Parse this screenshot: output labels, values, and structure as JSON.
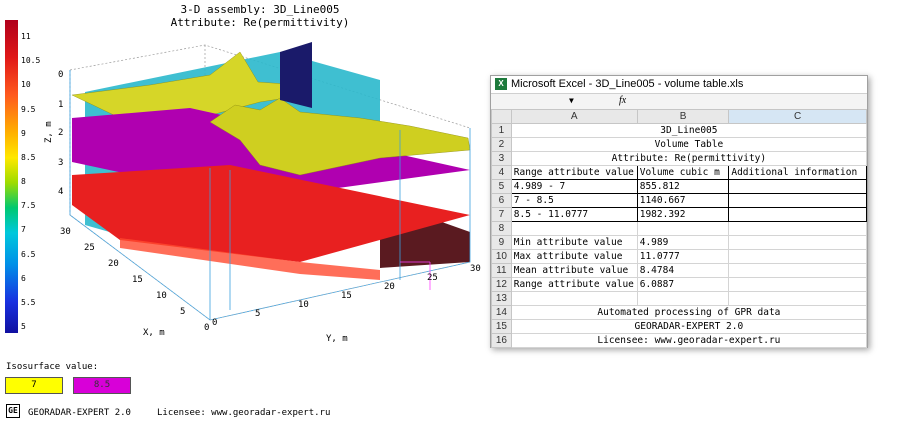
{
  "plot": {
    "title_line1": "3-D assembly: 3D_Line005",
    "title_line2": "Attribute: Re(permittivity)",
    "colorbar_ticks": [
      "11",
      "10.5",
      "10",
      "9.5",
      "9",
      "8.5",
      "8",
      "7.5",
      "7",
      "6.5",
      "6",
      "5.5",
      "5"
    ],
    "z_ticks": [
      "0",
      "1",
      "2",
      "3",
      "4"
    ],
    "x_ticks": [
      "30",
      "25",
      "20",
      "15",
      "10",
      "5",
      "0"
    ],
    "y_ticks": [
      "0",
      "5",
      "10",
      "15",
      "20",
      "25",
      "30"
    ],
    "z_label": "Z, m",
    "x_label": "X, m",
    "y_label": "Y, m",
    "colors": {
      "yellow_surface": "#dada22",
      "magenta_surface": "#b000b0",
      "cyan_surface": "#2ab8cc",
      "red_surface": "#e82020"
    }
  },
  "isosurface": {
    "label": "Isosurface value:",
    "value1": "7",
    "value2": "8.5",
    "color1": "#ffff00",
    "color2": "#d800d8"
  },
  "footer": {
    "logo": "GE",
    "brand": "GEORADAR-EXPERT 2.0",
    "licensee": "Licensee: www.georadar-expert.ru"
  },
  "excel": {
    "title": "Microsoft Excel - 3D_Line005 - volume table.xls",
    "icon": "X",
    "formula_dropdown": "▼",
    "fx": "fx",
    "columns": [
      "A",
      "B",
      "C"
    ],
    "rows": [
      {
        "n": "1",
        "merged": "3D_Line005"
      },
      {
        "n": "2",
        "merged": "Volume Table"
      },
      {
        "n": "3",
        "merged": "Attribute: Re(permittivity)"
      },
      {
        "n": "4",
        "a": "Range attribute value",
        "b": "Volume cubic m",
        "c": "Additional information"
      },
      {
        "n": "5",
        "a": "4.989 - 7",
        "b": "855.812",
        "c": ""
      },
      {
        "n": "6",
        "a": "7 - 8.5",
        "b": "1140.667",
        "c": ""
      },
      {
        "n": "7",
        "a": "8.5 - 11.0777",
        "b": "1982.392",
        "c": ""
      },
      {
        "n": "8",
        "a": "",
        "b": "",
        "c": ""
      },
      {
        "n": "9",
        "a": "Min attribute value",
        "b": "4.989",
        "c": ""
      },
      {
        "n": "10",
        "a": "Max attribute value",
        "b": "11.0777",
        "c": ""
      },
      {
        "n": "11",
        "a": "Mean attribute value",
        "b": "8.4784",
        "c": ""
      },
      {
        "n": "12",
        "a": "Range attribute value",
        "b": "6.0887",
        "c": ""
      },
      {
        "n": "13",
        "a": "",
        "b": "",
        "c": ""
      },
      {
        "n": "14",
        "merged": "Automated processing of GPR data"
      },
      {
        "n": "15",
        "merged": "GEORADAR-EXPERT 2.0"
      },
      {
        "n": "16",
        "merged": "Licensee: www.georadar-expert.ru"
      }
    ]
  }
}
